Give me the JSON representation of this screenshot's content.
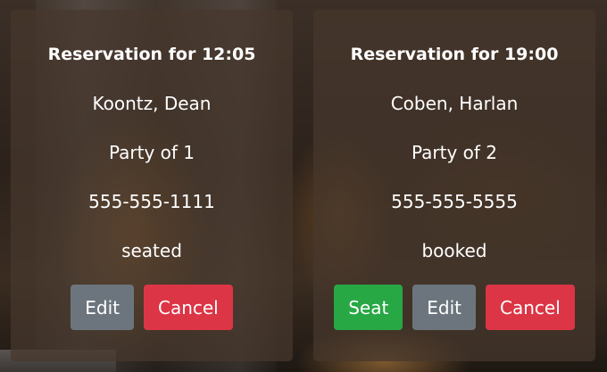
{
  "reservations": [
    {
      "title": "Reservation for 12:05",
      "name": "Koontz, Dean",
      "party": "Party of 1",
      "phone": "555-555-1111",
      "status": "seated",
      "buttons": {
        "edit": "Edit",
        "cancel": "Cancel"
      }
    },
    {
      "title": "Reservation for 19:00",
      "name": "Coben, Harlan",
      "party": "Party of 2",
      "phone": "555-555-5555",
      "status": "booked",
      "buttons": {
        "seat": "Seat",
        "edit": "Edit",
        "cancel": "Cancel"
      }
    }
  ],
  "colors": {
    "card_bg": "#46372d",
    "edit": "#6c757d",
    "cancel": "#dc3545",
    "seat": "#28a745"
  }
}
